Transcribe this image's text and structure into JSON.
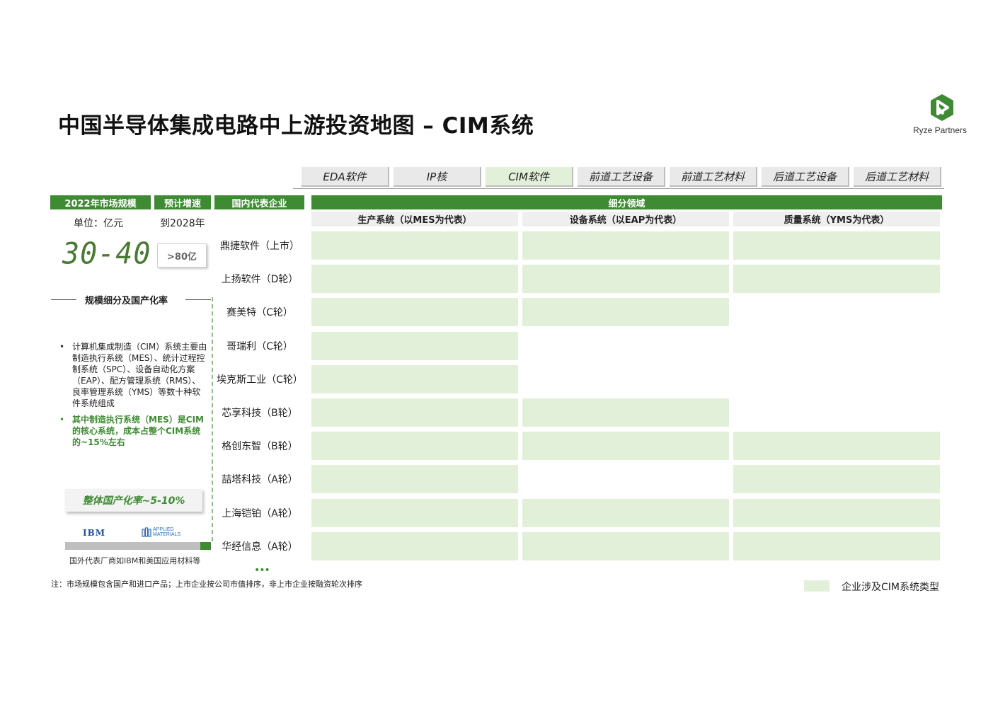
{
  "title": "中国半导体集成电路中上游投资地图 – CIM系统",
  "brand": {
    "name": "Ryze Partners",
    "color": "#3f8b34"
  },
  "tabs": [
    {
      "label": "EDA软件",
      "active": false
    },
    {
      "label": "IP核",
      "active": false
    },
    {
      "label": "CIM软件",
      "active": true
    },
    {
      "label": "前道工艺设备",
      "active": false
    },
    {
      "label": "前道工艺材料",
      "active": false
    },
    {
      "label": "后道工艺设备",
      "active": false
    },
    {
      "label": "后道工艺材料",
      "active": false
    }
  ],
  "headers": {
    "market_size": "2022年市场规模",
    "growth": "预计增速",
    "companies": "国内代表企业",
    "segments": "细分领域"
  },
  "market": {
    "unit": "单位：亿元",
    "value": "30-40",
    "growth_horizon": "到2028年",
    "growth_value": ">80亿"
  },
  "breakdown": {
    "title": "规模细分及国产化率",
    "bullets": [
      "计算机集成制造（CIM）系统主要由制造执行系统（MES）、统计过程控制系统（SPC）、设备自动化方案（EAP）、配方管理系统（RMS）、良率管理系统（YMS）等数十种软件系统组成",
      "其中制造执行系统（MES）是CIM的核心系统，成本占整个CIM系统的~15%左右"
    ],
    "localization_rate": "整体国产化率~5-10%",
    "localization_rate_value": 0.075,
    "foreign_logos": [
      "IBM",
      "APPLIED MATERIALS"
    ],
    "overseas_note": "国外代表厂商如IBM和美国应用材料等"
  },
  "segments": [
    "生产系统（以MES为代表）",
    "设备系统（以EAP为代表）",
    "质量系统（YMS为代表）"
  ],
  "companies": [
    {
      "name": "鼎捷软件（上市）",
      "coverage": [
        true,
        true,
        true
      ]
    },
    {
      "name": "上扬软件（D轮）",
      "coverage": [
        true,
        true,
        true
      ]
    },
    {
      "name": "赛美特（C轮）",
      "coverage": [
        true,
        true,
        false
      ]
    },
    {
      "name": "哥瑞利（C轮）",
      "coverage": [
        true,
        false,
        false
      ]
    },
    {
      "name": "埃克斯工业（C轮）",
      "coverage": [
        true,
        false,
        false
      ]
    },
    {
      "name": "芯享科技（B轮）",
      "coverage": [
        true,
        true,
        false
      ]
    },
    {
      "name": "格创东智（B轮）",
      "coverage": [
        true,
        true,
        true
      ]
    },
    {
      "name": "喆塔科技（A轮）",
      "coverage": [
        true,
        false,
        true
      ]
    },
    {
      "name": "上海铠铂（A轮）",
      "coverage": [
        true,
        true,
        true
      ]
    },
    {
      "name": "华经信息（A轮）",
      "coverage": [
        true,
        true,
        true
      ]
    }
  ],
  "more_indicator": "•••",
  "footnote": "注：市场规模包含国产和进口产品；上市企业按公司市值排序，非上市企业按融资轮次排序",
  "legend": {
    "label": "企业涉及CIM系统类型",
    "color": "#e2f0d9"
  }
}
